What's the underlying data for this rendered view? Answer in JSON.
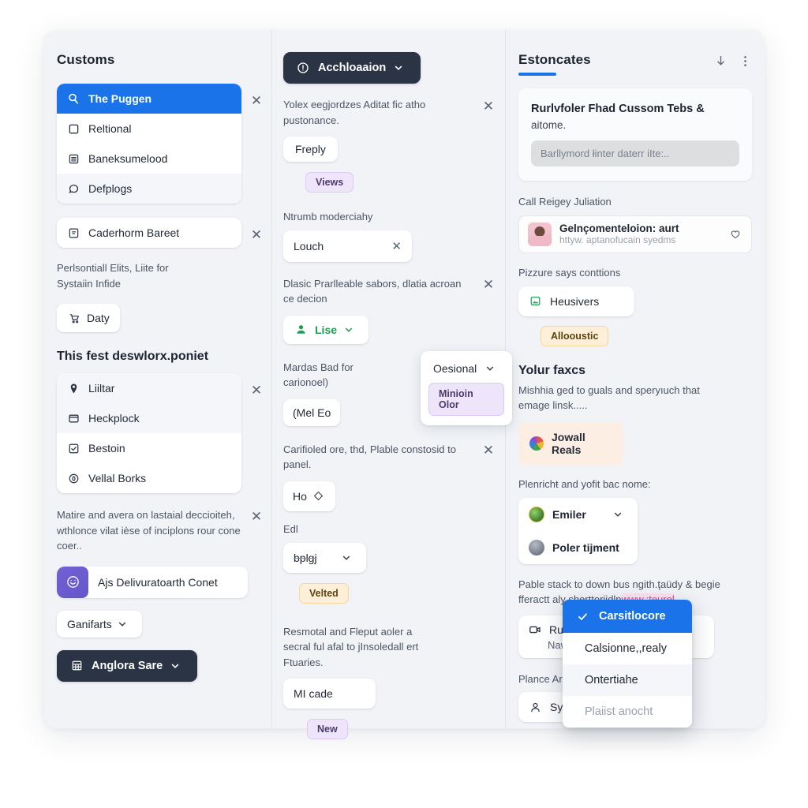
{
  "left": {
    "title": "Customs",
    "nav": {
      "items": [
        {
          "label": "The Puggen",
          "icon": "search-icon",
          "selected": true
        },
        {
          "label": "Reltional",
          "icon": "square-icon",
          "selected": false
        },
        {
          "label": "Baneksumelood",
          "icon": "list-icon",
          "selected": false
        },
        {
          "label": "Defplogs",
          "icon": "chat-bubble-icon",
          "selected": false
        }
      ]
    },
    "second_card": {
      "label": "Caderhorm Bareet",
      "icon": "note-icon"
    },
    "note_text": "Perlsontiall Elits, Liite for Systaiin Infide",
    "cart_button": {
      "label": "Daty",
      "icon": "cart-icon"
    },
    "section_title": "This fest deswlorx.poniet",
    "list2": [
      {
        "label": "Liiltar",
        "icon": "pin-icon"
      },
      {
        "label": "Heckplock",
        "icon": "window-icon"
      },
      {
        "label": "Bestoin",
        "icon": "check-square-icon"
      },
      {
        "label": "Vellal Borks",
        "icon": "zero-circle-icon"
      }
    ],
    "bottom_text": "Matire and avera on lastaial deccioiteh, wthlonce vilat ièse of inciplons rour cone coer..",
    "action_card": {
      "label": "Ajs Delivuratoarth Conet",
      "icon": "smiley-icon"
    },
    "dropdown": {
      "label": "Ganifarts"
    },
    "dark_button": {
      "label": "Anglora Sare",
      "icon": "grid-icon"
    }
  },
  "mid": {
    "top_button": {
      "label": "Acchloaaion",
      "icon": "info-circle-icon"
    },
    "block1": {
      "text": "Yolex eegjordzes Aditat fic atho pustonance.",
      "button": "Freply",
      "badge": "Views"
    },
    "field1": {
      "label": "Ntrumb moderciahy",
      "value": "Louch"
    },
    "block2": {
      "text": "Dlasic Prarlleable sabors, dlatia acroan ce decion",
      "select": "Lise"
    },
    "block3": {
      "text": "Mardas Bad for carionoel)",
      "value": "(Mel Eo"
    },
    "popover": {
      "select": "Oesional",
      "badge": "Minioin Olor"
    },
    "block4": {
      "text": "Carifioled ore, thd, Plable constosid to panel.",
      "stepper": "Ho"
    },
    "field2": {
      "label": "Edl",
      "value": "bplgj",
      "badge": "Velted"
    },
    "block5": {
      "text": "Resmotal and Fleput aoler a secral ful afal to jInsoledall ert Ftuaries.",
      "value": "MI cade",
      "badge": "New"
    }
  },
  "right": {
    "title": "Estoncates",
    "icons": {
      "download": "download-icon",
      "more": "more-vertical-icon"
    },
    "hero": {
      "title": "Rurlvfoler Fhad Cussom Tebs &",
      "subtitle": "aitome.",
      "field_placeholder": "Barllymord łinter daterr iIte:.."
    },
    "contact": {
      "label": "Call Reigey Juliation",
      "name": "Gelnçomenteloion: aurt",
      "url": "httyw. aptanofucain syedms",
      "icon": "heart-icon"
    },
    "conditions": {
      "label": "Pizzure says conttions",
      "item": "Heusivers",
      "item_icon": "image-green-icon",
      "badge": "Allooustic"
    },
    "faxes": {
      "title": "Yolur faxcs",
      "text": "Mishhia ged to guals and speryıuch that emage linsk.....",
      "chip": "Jowall Reals",
      "chip_icon": "rainbow-icon"
    },
    "people": {
      "label": "Plenrichŧ and yofit bac nome:",
      "items": [
        {
          "name": "Emiler",
          "has_chevron": true
        },
        {
          "name": "Poler tijment",
          "has_chevron": false
        }
      ]
    },
    "stack": {
      "text": "Pable stack to down bus ngith.ţaüdy & begie fferactt aly sherttoriidln",
      "link": "www.:ţeųrel"
    },
    "runic_card": {
      "label": "Runic",
      "sub": "Naw C",
      "icon": "video-icon"
    },
    "place": {
      "label": "Plance Ard",
      "item": "Sysiic",
      "icon": "user-icon"
    }
  },
  "context_menu": {
    "items": [
      {
        "label": "Carsitlocore",
        "selected": true,
        "icon": "check-icon"
      },
      {
        "label": "Calsionne,,realy",
        "selected": false
      },
      {
        "label": "Ontertiahe",
        "selected": false
      },
      {
        "label": "Plaiist anocht",
        "selected": false,
        "dim": true
      }
    ]
  },
  "colors": {
    "accent_blue": "#1a73e8",
    "dark": "#2b3445",
    "violet_badge": "#eee5fb",
    "amber_badge": "#fdefd8",
    "page_bg": "#f1f3f7",
    "link_pink": "#e0449e"
  }
}
